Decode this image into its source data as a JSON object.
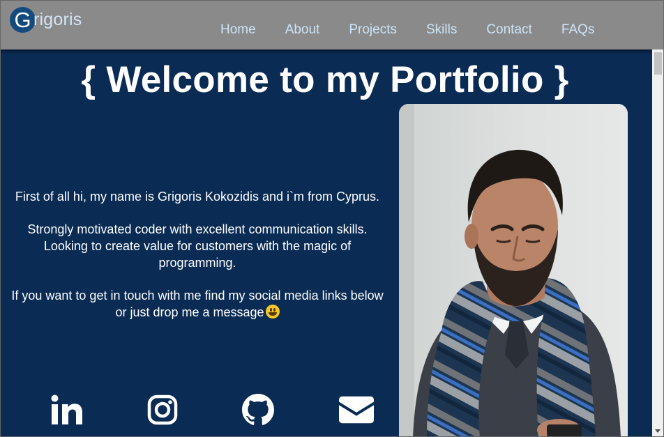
{
  "header": {
    "logo_letter": "G",
    "logo_rest": "rigoris",
    "nav": [
      {
        "label": "Home"
      },
      {
        "label": "About"
      },
      {
        "label": "Projects"
      },
      {
        "label": "Skills"
      },
      {
        "label": "Contact"
      },
      {
        "label": "FAQs"
      }
    ]
  },
  "main": {
    "title": "{ Welcome to my Portfolio }",
    "paragraphs": [
      "First of all hi, my name is Grigoris Kokozidis and i`m from Cyprus.",
      "Strongly motivated coder with excellent communication skills. Looking to create value for customers with the magic of programming.",
      "If you want to get in touch with me find my social media links below or just drop me a message"
    ],
    "emoji": "grinning-face-emoji"
  },
  "socials": [
    {
      "icon": "linkedin-icon"
    },
    {
      "icon": "instagram-icon"
    },
    {
      "icon": "github-icon"
    },
    {
      "icon": "envelope-icon"
    }
  ],
  "colors": {
    "background": "#0a2b53",
    "header": "#8a8a8a",
    "nav_text": "#cbe4f8",
    "logo_circle": "#154a7d"
  }
}
